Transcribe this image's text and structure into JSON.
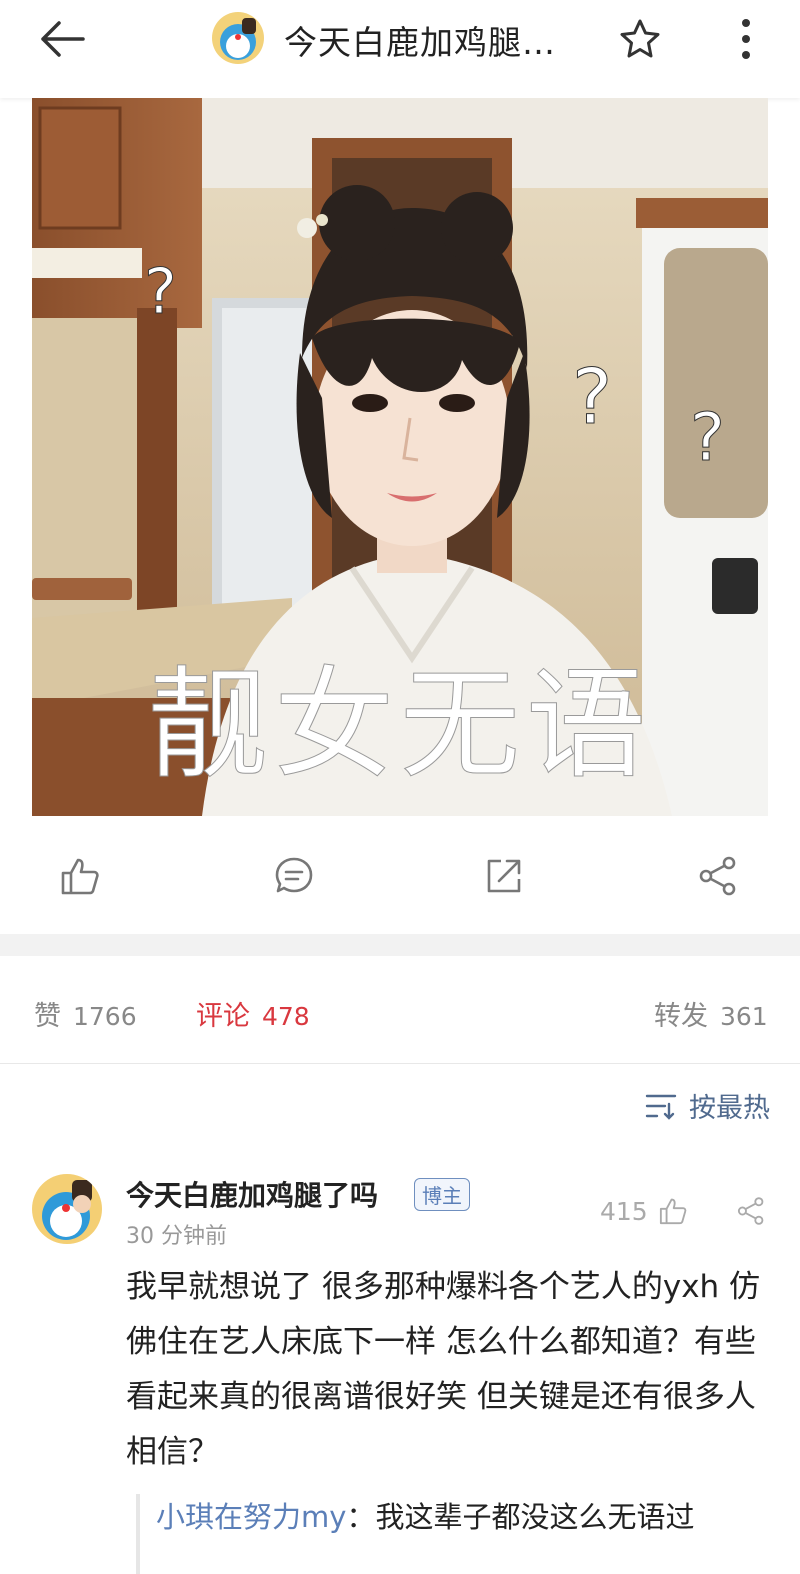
{
  "header": {
    "title": "今天白鹿加鸡腿…",
    "back_icon": "arrow-left-icon",
    "star_icon": "star-outline-icon",
    "more_icon": "more-vertical-icon"
  },
  "post_image": {
    "caption_overlay": "靓女无语",
    "question_marks": [
      "?",
      "?",
      "?"
    ]
  },
  "action_bar": {
    "icons": [
      "thumbs-up-icon",
      "comment-icon",
      "repost-icon",
      "share-icon"
    ]
  },
  "stats": {
    "likes_label": "赞",
    "likes_count": "1766",
    "comments_label": "评论",
    "comments_count": "478",
    "reposts_label": "转发",
    "reposts_count": "361"
  },
  "sort": {
    "label": "按最热"
  },
  "comment": {
    "author": "今天白鹿加鸡腿了吗",
    "badge": "博主",
    "time": "30 分钟前",
    "likes": "415",
    "text": "我早就想说了 很多那种爆料各个艺人的yxh 仿佛住在艺人床底下一样 怎么什么都知道？有些看起来真的很离谱很好笑 但关键是还有很多人相信？",
    "reply": {
      "author": "小琪在努力my",
      "separator": "：",
      "text": "我这辈子都没这么无语过"
    }
  },
  "colors": {
    "accent_red": "#d9383f",
    "link_blue": "#5b7fb8",
    "muted_gray": "#888888"
  }
}
